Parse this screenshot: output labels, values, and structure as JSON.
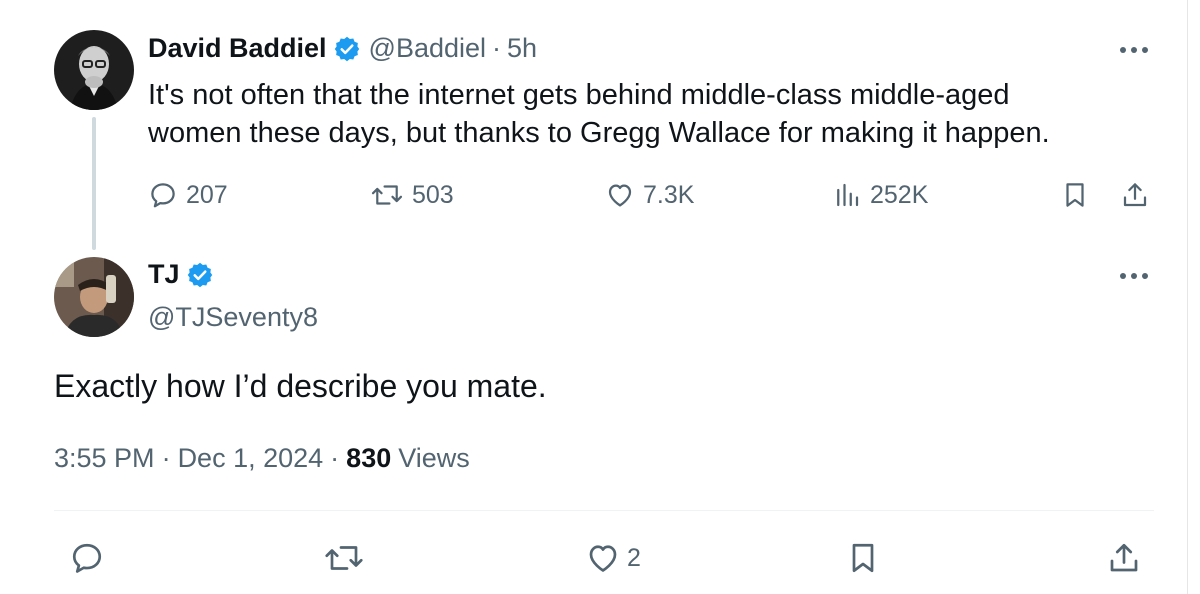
{
  "colors": {
    "text": "#0f1419",
    "secondary": "#536471",
    "verified": "#1d9bf0",
    "thread_line": "#cfd9de"
  },
  "original_tweet": {
    "author_name": "David Baddiel",
    "verified": true,
    "handle": "@Baddiel",
    "separator": "·",
    "time": "5h",
    "text_line1": "It's not often that the internet gets behind middle-class middle-aged",
    "text_line2": "women these days, but thanks to Gregg Wallace for making it happen.",
    "replies": "207",
    "reposts": "503",
    "likes": "7.3K",
    "views": "252K",
    "icons": [
      "reply-icon",
      "repost-icon",
      "like-icon",
      "views-icon",
      "bookmark-icon",
      "share-icon",
      "more-icon"
    ]
  },
  "reply_tweet": {
    "author_name": "TJ",
    "verified": true,
    "handle": "@TJSeventy8",
    "text": "Exactly how I’d describe you mate.",
    "time": "3:55 PM",
    "separator1": "·",
    "date": "Dec 1, 2024",
    "separator2": "·",
    "views_count": "830",
    "views_label": "Views",
    "likes": "2",
    "icons": [
      "reply-icon",
      "repost-icon",
      "like-icon",
      "bookmark-icon",
      "share-icon",
      "more-icon"
    ]
  }
}
